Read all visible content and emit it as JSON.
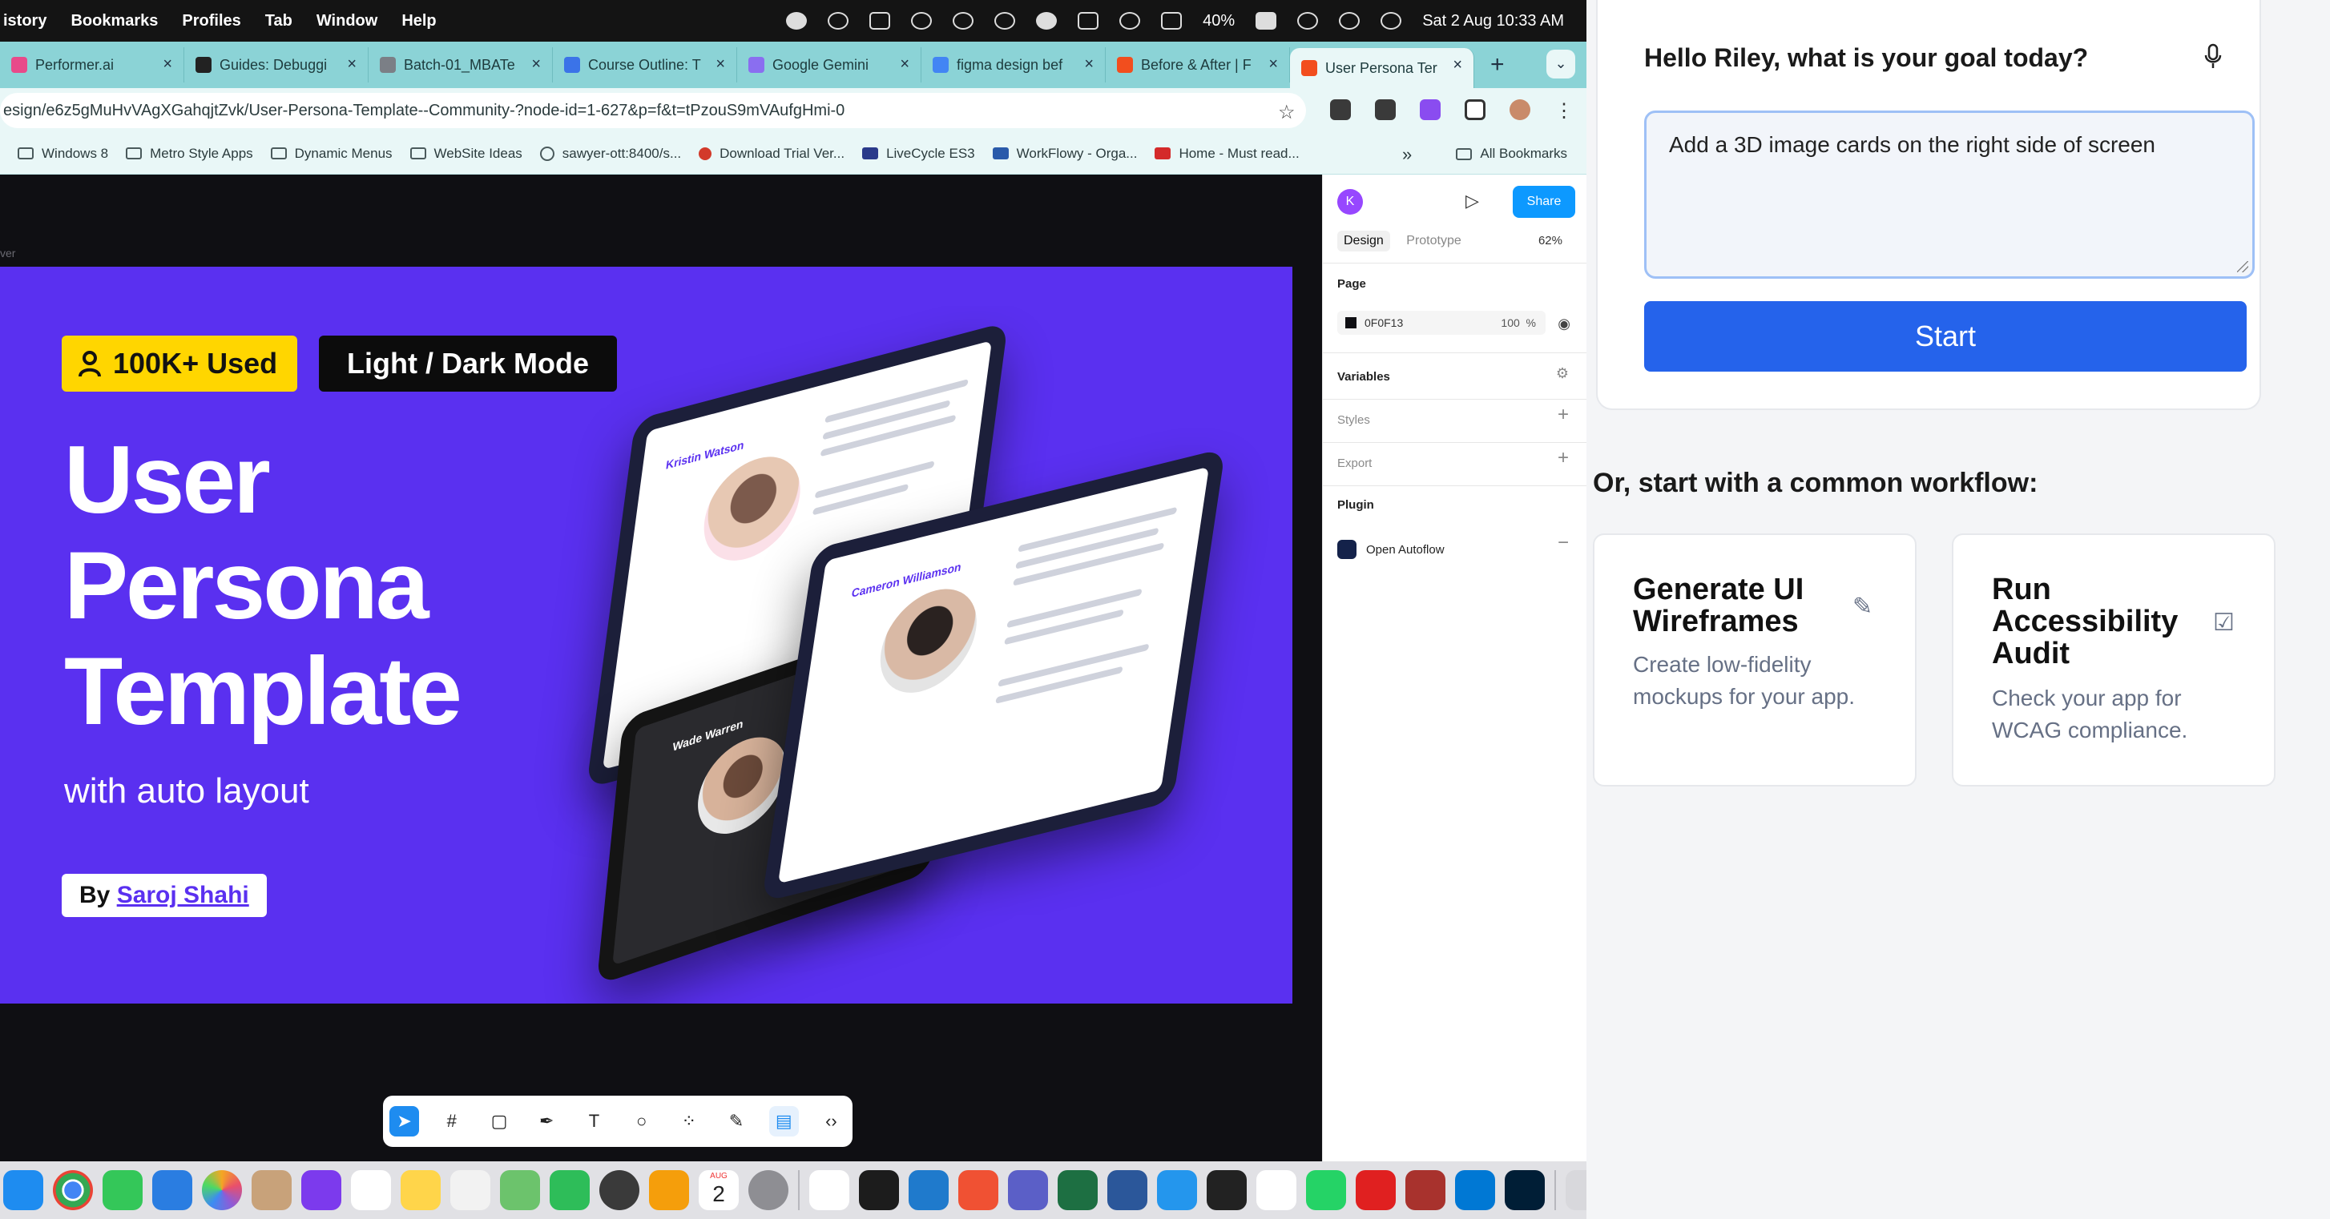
{
  "menubar": {
    "items": [
      "istory",
      "Bookmarks",
      "Profiles",
      "Tab",
      "Window",
      "Help"
    ],
    "battery": "40%",
    "datetime": "Sat 2 Aug  10:33 AM"
  },
  "browser": {
    "tabs": [
      {
        "label": "Performer.ai",
        "color": "#e84a8a"
      },
      {
        "label": "Guides: Debuggi",
        "color": "#222222"
      },
      {
        "label": "Batch-01_MBATe",
        "color": "#7b7f86"
      },
      {
        "label": "Course Outline: T",
        "color": "#3b73e8"
      },
      {
        "label": "Google Gemini",
        "color": "#8a6ef0"
      },
      {
        "label": "figma design bef",
        "color": "#4285f4"
      },
      {
        "label": "Before & After | F",
        "color": "#f24e1e"
      },
      {
        "label": "User Persona Ter",
        "color": "#f24e1e",
        "active": true
      }
    ],
    "new_tab": "+",
    "url": "esign/e6z5gMuHvVAgXGahqjtZvk/User-Persona-Template--Community-?node-id=1-627&p=f&t=tPzouS9mVAufgHmi-0",
    "bookmarks": [
      "Windows 8",
      "Metro Style Apps",
      "Dynamic Menus",
      "WebSite Ideas",
      "sawyer-ott:8400/s...",
      "Download Trial Ver...",
      "LiveCycle ES3",
      "WorkFlowy - Orga...",
      "Home - Must read..."
    ],
    "bookmarks_overflow": "»",
    "all_bookmarks": "All Bookmarks"
  },
  "figma": {
    "artboard_label": "ver",
    "artwork": {
      "badge_used": "100K+ Used",
      "badge_mode": "Light / Dark Mode",
      "title": "User\nPersona\nTemplate",
      "subtitle": "with auto layout",
      "by_prefix": "By ",
      "author": "Saroj Shahi",
      "persona_names": [
        "Kristin Watson",
        "Cameron Williamson",
        "Wade Warren"
      ]
    },
    "panel": {
      "user_initial": "K",
      "share_label": "Share",
      "tab_design": "Design",
      "tab_prototype": "Prototype",
      "zoom": "62%",
      "page_section": "Page",
      "page_color": "0F0F13",
      "page_opacity": "100",
      "page_opacity_unit": "%",
      "variables": "Variables",
      "styles": "Styles",
      "export": "Export",
      "plugin": "Plugin",
      "plugin_name": "Open Autoflow"
    },
    "help": "?"
  },
  "dock": {
    "calendar_day": "2",
    "calendar_month": "AUG"
  },
  "assistant": {
    "greeting": "Hello Riley, what is your goal today?",
    "goal_value": "Add a 3D image cards on the right side of screen",
    "start_label": "Start",
    "workflow_heading": "Or, start with a common workflow:",
    "workflows": [
      {
        "title": "Generate UI Wireframes",
        "desc": "Create low-fidelity mockups for your app.",
        "icon": "pencil-icon"
      },
      {
        "title": "Run Accessibility Audit",
        "desc": "Check your app for WCAG compliance.",
        "icon": "checkbox-icon"
      }
    ]
  },
  "colors": {
    "accent": "#2563eb",
    "artwork_bg": "#5a30f0",
    "figma_blue": "#0d99ff",
    "badge_yellow": "#ffd600"
  }
}
